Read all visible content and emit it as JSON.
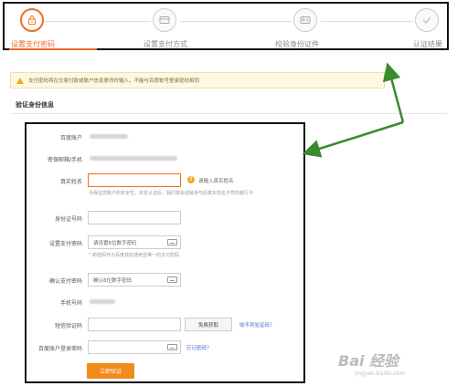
{
  "stepper": {
    "steps": [
      {
        "label": "设置支付密码",
        "active": true,
        "icon": "lock-icon"
      },
      {
        "label": "设置支付方式",
        "active": false,
        "icon": "card-icon"
      },
      {
        "label": "校验身份证件",
        "active": false,
        "icon": "id-card-icon"
      },
      {
        "label": "认证结果",
        "active": false,
        "icon": "check-icon"
      }
    ]
  },
  "notice": {
    "text": "支付密码将在交易付款或账户信息更改时输入，不能与百度帐号登录密码相同"
  },
  "section_title": "验证身份信息",
  "form": {
    "account_label": "百度账户",
    "email_phone_label": "密保邮箱/手机",
    "real_name_label": "真实姓名",
    "real_name_error": "请输入真实姓名",
    "real_name_hint": "为保证您账户的安全性，实名认证后，我们将会成解身与后真实姓名不符的银行卡",
    "id_number_label": "身份证号码",
    "pay_password_label": "设置支付密码",
    "pay_password_placeholder": "请设置6位数字密码",
    "pay_password_hint": "* 新密码作为百度钱包通用且唯一的支付密码",
    "confirm_password_label": "确认支付密码",
    "confirm_password_placeholder": "确认6位数字密码",
    "phone_label": "手机号码",
    "sms_label": "短信验证码",
    "sms_button": "免费获取",
    "sms_link": "收不到验证码？",
    "login_password_label": "百度账户登录密码",
    "forgot_link": "忘记密码？",
    "submit": "立即验证"
  },
  "watermark": {
    "main": "Bai 经验",
    "sub": "jingyan.baidu.com"
  },
  "colors": {
    "accent": "#f26a24",
    "submit": "#f28a1c",
    "link": "#3b6fc7",
    "annotation_arrow": "#3a8a2f"
  }
}
